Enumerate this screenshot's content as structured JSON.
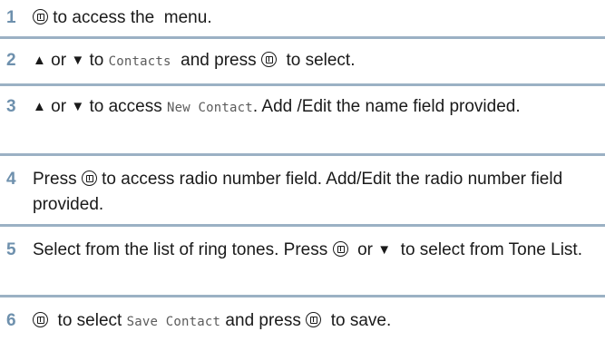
{
  "steps": [
    {
      "number": "1",
      "parts": [
        {
          "t": "icon",
          "name": "menu-ok-button-icon"
        },
        {
          "t": "text",
          "v": " to access the  menu."
        }
      ]
    },
    {
      "number": "2",
      "parts": [
        {
          "t": "arrow",
          "v": "▲",
          "name": "up-arrow-icon"
        },
        {
          "t": "text",
          "v": " or "
        },
        {
          "t": "arrow",
          "v": "▼",
          "name": "down-arrow-icon"
        },
        {
          "t": "text",
          "v": " to "
        },
        {
          "t": "mono",
          "v": "Contacts"
        },
        {
          "t": "text",
          "v": "  and press "
        },
        {
          "t": "icon",
          "name": "menu-ok-button-icon"
        },
        {
          "t": "text",
          "v": "  to select."
        }
      ]
    },
    {
      "number": "3",
      "parts": [
        {
          "t": "arrow",
          "v": "▲",
          "name": "up-arrow-icon"
        },
        {
          "t": "text",
          "v": " or "
        },
        {
          "t": "arrow",
          "v": "▼",
          "name": "down-arrow-icon"
        },
        {
          "t": "text",
          "v": " to access "
        },
        {
          "t": "mono",
          "v": "New Contact"
        },
        {
          "t": "text",
          "v": ". Add /Edit the name field provided."
        }
      ]
    },
    {
      "number": "4",
      "parts": [
        {
          "t": "text",
          "v": "Press "
        },
        {
          "t": "icon",
          "name": "menu-ok-button-icon"
        },
        {
          "t": "text",
          "v": " to access radio number field. Add/Edit the radio number field provided."
        }
      ]
    },
    {
      "number": "5",
      "parts": [
        {
          "t": "text",
          "v": "Select from the list of ring tones. Press "
        },
        {
          "t": "icon",
          "name": "menu-ok-button-icon"
        },
        {
          "t": "text",
          "v": "  or "
        },
        {
          "t": "arrow",
          "v": "▼",
          "name": "down-arrow-icon"
        },
        {
          "t": "text",
          "v": "  to select from Tone List."
        }
      ]
    },
    {
      "number": "6",
      "parts": [
        {
          "t": "icon",
          "name": "menu-ok-button-icon"
        },
        {
          "t": "text",
          "v": "  to select "
        },
        {
          "t": "mono",
          "v": "Save Contact"
        },
        {
          "t": "text",
          "v": " and press "
        },
        {
          "t": "icon",
          "name": "menu-ok-button-icon"
        },
        {
          "t": "text",
          "v": "  to save."
        }
      ]
    }
  ]
}
